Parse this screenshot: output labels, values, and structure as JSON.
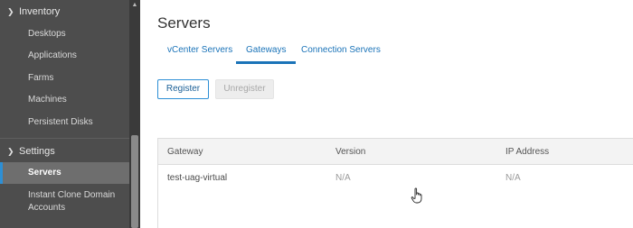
{
  "sidebar": {
    "inventory_label": "Inventory",
    "inventory_items": [
      "Desktops",
      "Applications",
      "Farms",
      "Machines",
      "Persistent Disks"
    ],
    "settings_label": "Settings",
    "settings_items": [
      "Servers",
      "Instant Clone Domain Accounts"
    ],
    "active_item": "Servers"
  },
  "page": {
    "title": "Servers",
    "tabs": [
      "vCenter Servers",
      "Gateways",
      "Connection Servers"
    ],
    "active_tab": "Gateways"
  },
  "actions": {
    "register": "Register",
    "unregister": "Unregister"
  },
  "table": {
    "headers": [
      "Gateway",
      "Version",
      "IP Address"
    ],
    "rows": [
      [
        "test-uag-virtual",
        "N/A",
        "N/A"
      ]
    ]
  },
  "colors": {
    "accent": "#1a73b8",
    "sidebar_bg": "#4d4d4d"
  },
  "icons": {
    "section_expand": "chevron-down-icon",
    "cursor": "hand-pointer-icon"
  }
}
